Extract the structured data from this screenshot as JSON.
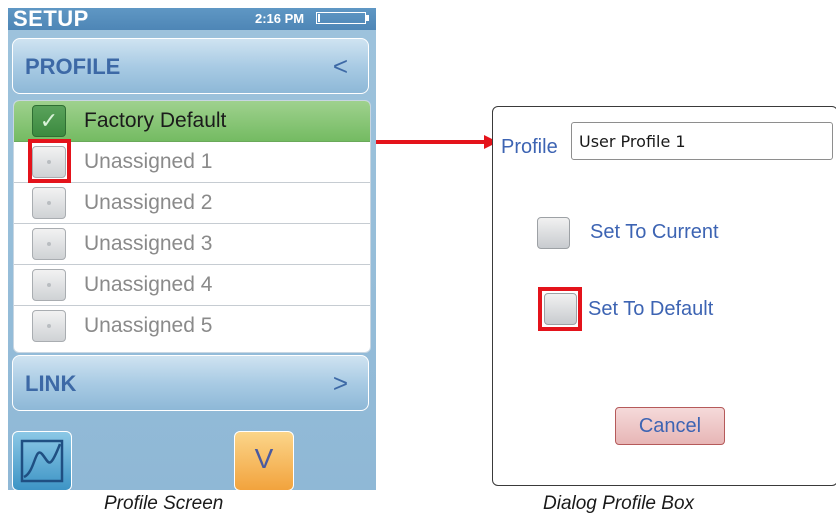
{
  "device": {
    "status_bar": {
      "title": "SETUP",
      "time": "2:16 PM",
      "battery_level": 0.05
    },
    "profile_section": {
      "title": "PROFILE",
      "collapse_glyph": "<"
    },
    "profiles": [
      {
        "label": "Factory Default",
        "selected": true
      },
      {
        "label": "Unassigned 1",
        "selected": false
      },
      {
        "label": "Unassigned 2",
        "selected": false
      },
      {
        "label": "Unassigned 3",
        "selected": false
      },
      {
        "label": "Unassigned 4",
        "selected": false
      },
      {
        "label": "Unassigned 5",
        "selected": false
      }
    ],
    "link_section": {
      "title": "LINK",
      "expand_glyph": ">"
    },
    "footer": {
      "graph_icon": "graph-icon",
      "down_glyph": "V"
    }
  },
  "dialog": {
    "profile_label": "Profile",
    "profile_value": "User Profile 1",
    "set_current_label": "Set To Current",
    "set_default_label": "Set To Default",
    "cancel_label": "Cancel"
  },
  "captions": {
    "left": "Profile Screen",
    "right": "Dialog Profile Box"
  },
  "colors": {
    "highlight": "#e4131b",
    "selected_row": "#74bb62",
    "header_text": "#3d69a6",
    "dialog_text": "#3d64b3"
  }
}
